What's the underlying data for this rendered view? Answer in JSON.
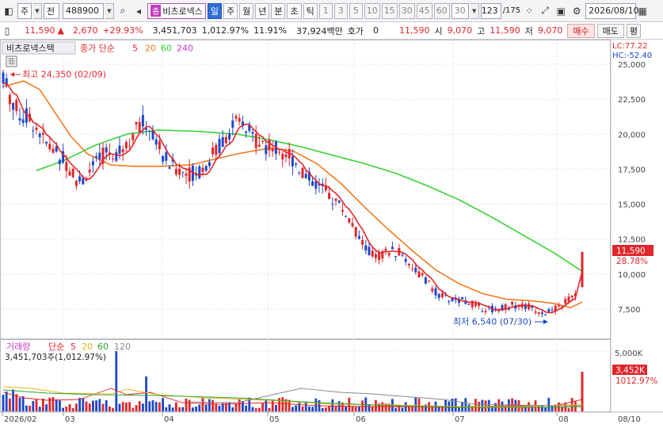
{
  "toolbar": {
    "icon_left": "chart-type-icon",
    "market": "주",
    "period_type": "전",
    "code": "488900",
    "search_icon": "magnifier-icon",
    "audio_icon": "speaker-icon",
    "name_badge": "종",
    "name": "비츠로넥스",
    "period_buttons": [
      "일",
      "주",
      "월",
      "년",
      "분",
      "초",
      "틱"
    ],
    "selected_period": "일",
    "minute_buttons": [
      "1",
      "3",
      "5",
      "10",
      "15",
      "30",
      "45",
      "60"
    ],
    "minute_value": "30",
    "count": "123",
    "count_total": "/175",
    "date": "2026/08/10"
  },
  "quote": {
    "price": "11,590",
    "arrow": "▲",
    "change": "2,670",
    "change_pct": "+29.93%",
    "volume": "3,451,703",
    "volume_ratio": "1,012.97%",
    "turnover": "11.91%",
    "amount": "37,924백만",
    "hoga_label": "호가",
    "hoga_value": "0",
    "ask": "11,590",
    "open_label": "시",
    "open": "9,070",
    "high_label": "고",
    "high": "11,590",
    "low_label": "저",
    "low": "9,070",
    "buy_button": "매수",
    "sell_button": "매도",
    "eval_button": "평"
  },
  "price_panel": {
    "title": "비츠로넥스텍",
    "ma_label": "종가 단순",
    "ma_periods": [
      "5",
      "20",
      "60",
      "240"
    ],
    "lc": "LC:77.22",
    "hc": "HC:-52.40",
    "high_note": "최고 24,350 (02/09)",
    "low_note": "최저 6,540 (07/30)",
    "last_price": "11,590",
    "last_pct": "28.78%",
    "y_ticks": [
      "25,000",
      "22,500",
      "20,000",
      "17,500",
      "15,000",
      "12,500",
      "10,000",
      "7,500"
    ]
  },
  "volume_panel": {
    "title": "거래량",
    "ma_label": "단순",
    "ma_periods": [
      "5",
      "20",
      "60",
      "120"
    ],
    "info": "3,451,703주(1,012.97%)",
    "y_tick": "5,000K",
    "last_value": "3,452K",
    "last_pct": "1012.97%"
  },
  "x_axis": [
    "2026/02",
    "03",
    "04",
    "05",
    "06",
    "07",
    "08",
    "08/10"
  ],
  "colors": {
    "up": "#e0262a",
    "down": "#1e47c8",
    "ma5": "#e0262a",
    "ma20": "#f07a1e",
    "ma60": "#39d334",
    "ma240": "#c83cc8"
  }
}
